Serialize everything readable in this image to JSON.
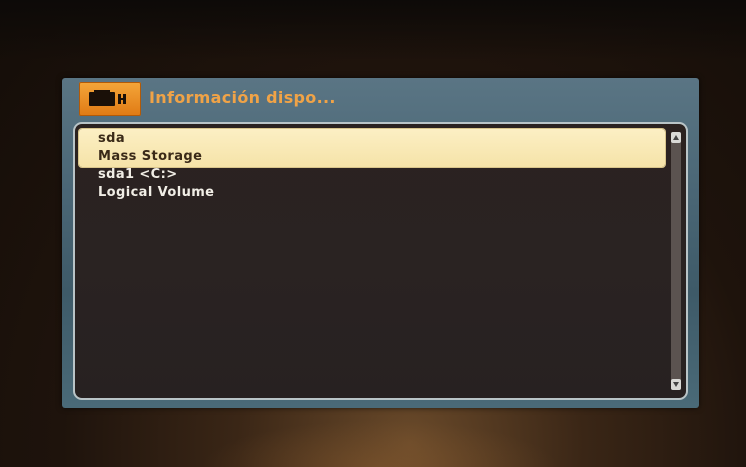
{
  "window": {
    "title": "Información dispo...",
    "icon": "device-info-icon"
  },
  "list": {
    "items": [
      {
        "label": "sda",
        "selected": true
      },
      {
        "label": "Mass Storage",
        "selected": true
      },
      {
        "label": "sda1 <C:>",
        "selected": false
      },
      {
        "label": "Logical Volume",
        "selected": false
      }
    ]
  },
  "scrollbar": {
    "up_icon": "arrow-up-icon",
    "down_icon": "arrow-down-icon"
  },
  "colors": {
    "title": "#f0a347",
    "selection": "#f8e9b6",
    "panel": "#2a2322",
    "frame": "#4a6675"
  }
}
